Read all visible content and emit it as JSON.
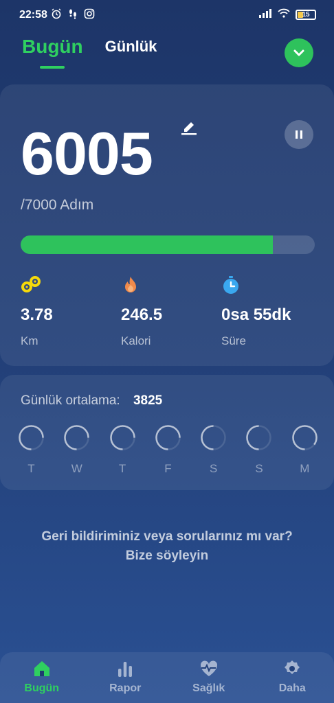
{
  "status_bar": {
    "time": "22:58",
    "battery": "15"
  },
  "header": {
    "tabs": [
      {
        "label": "Bugün",
        "active": true
      },
      {
        "label": "Günlük",
        "active": false
      }
    ]
  },
  "steps": {
    "value": "6005",
    "goal_text": "/7000 Adım",
    "progress": 0.858
  },
  "stats": [
    {
      "value": "3.78",
      "unit": "Km",
      "icon": "distance-icon",
      "color": "#f5d90a"
    },
    {
      "value": "246.5",
      "unit": "Kalori",
      "icon": "flame-icon",
      "color": "#f08a4b"
    },
    {
      "value": "0sa 55dk",
      "unit": "Süre",
      "icon": "clock-icon",
      "color": "#3aa8f0"
    }
  ],
  "daily_average": {
    "label": "Günlük ortalama:",
    "value": "3825",
    "days": [
      {
        "label": "T",
        "progress": 0.75
      },
      {
        "label": "W",
        "progress": 0.75
      },
      {
        "label": "T",
        "progress": 0.75
      },
      {
        "label": "F",
        "progress": 0.75
      },
      {
        "label": "S",
        "progress": 0.5
      },
      {
        "label": "S",
        "progress": 0.5
      },
      {
        "label": "M",
        "progress": 0.85
      }
    ]
  },
  "feedback": {
    "line1": "Geri bildiriminiz veya sorularınız mı var?",
    "line2": "Bize söyleyin"
  },
  "bottom_nav": [
    {
      "label": "Bugün",
      "icon": "home-icon",
      "active": true
    },
    {
      "label": "Rapor",
      "icon": "bar-chart-icon",
      "active": false
    },
    {
      "label": "Sağlık",
      "icon": "heart-pulse-icon",
      "active": false
    },
    {
      "label": "Daha",
      "icon": "gear-icon",
      "active": false
    }
  ],
  "colors": {
    "accent": "#2fd060",
    "progress": "#2ec25c"
  }
}
